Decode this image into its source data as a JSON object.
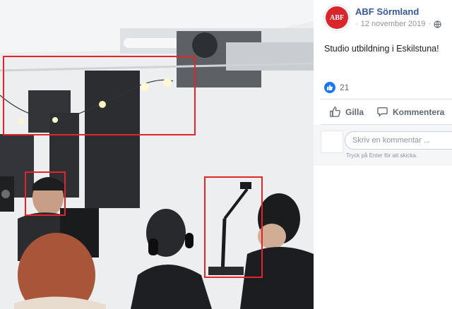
{
  "post": {
    "page_name": "ABF Sörmland",
    "logo_text": "ABF",
    "date": "12 november 2019",
    "separator": "·",
    "text": "Studio utbildning i Eskilstuna!",
    "reaction_count": "21"
  },
  "actions": {
    "like_label": "Gilla",
    "comment_label": "Kommentera"
  },
  "comment_box": {
    "placeholder": "Skriv en kommentar ...",
    "hint": "Tryck på Enter för att skicka."
  },
  "colors": {
    "brand_red": "#d7262d",
    "link_blue": "#385898",
    "like_blue": "#1877f2",
    "annotation_red": "#e0262b"
  },
  "icons": [
    "globe-icon",
    "like-reaction-icon",
    "thumbs-up-icon",
    "comment-icon"
  ]
}
